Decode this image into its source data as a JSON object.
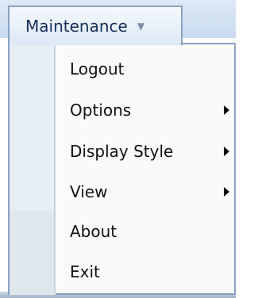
{
  "menu": {
    "title": "Maintenance",
    "dropdown_icon": "chevron-down-icon",
    "items": [
      {
        "label": "Logout",
        "has_submenu": false
      },
      {
        "label": "Options",
        "has_submenu": true
      },
      {
        "label": "Display Style",
        "has_submenu": true
      },
      {
        "label": "View",
        "has_submenu": true
      },
      {
        "label": "About",
        "has_submenu": false
      },
      {
        "label": "Exit",
        "has_submenu": false
      }
    ]
  },
  "colors": {
    "menu_border": "#8aa2c2",
    "menu_title_text": "#15305a",
    "icon_column": "#e6edf3",
    "dropdown_background": "#fafafa"
  }
}
